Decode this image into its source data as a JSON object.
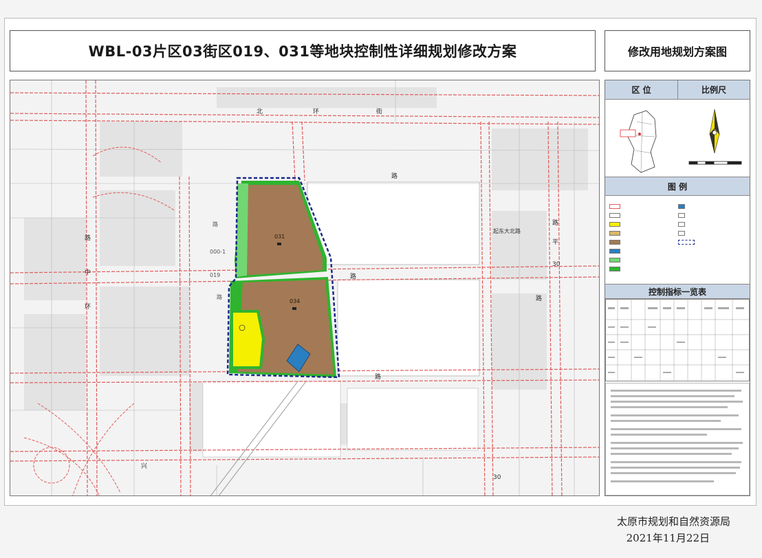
{
  "header": {
    "title": "WBL-03片区03街区019、031等地块控制性详细规划修改方案",
    "subtitle": "修改用地规划方案图"
  },
  "map": {
    "parcel_labels": [
      "031",
      "034"
    ]
  },
  "side_panel": {
    "location_heading": "区 位",
    "scale_heading": "比例尺",
    "legend_heading": "图 例",
    "table_heading": "控制指标一览表"
  },
  "footer": {
    "organization": "太原市规划和自然资源局",
    "date": "2021年11月22日"
  },
  "colors": {
    "road_line": "#e05a5a",
    "residential": "#a37a55",
    "school": "#f5f000",
    "green_space": "#33b533",
    "boundary": "#1a2a8a",
    "facility": "#2a7fc0",
    "panel_header": "#c9d6e6"
  }
}
